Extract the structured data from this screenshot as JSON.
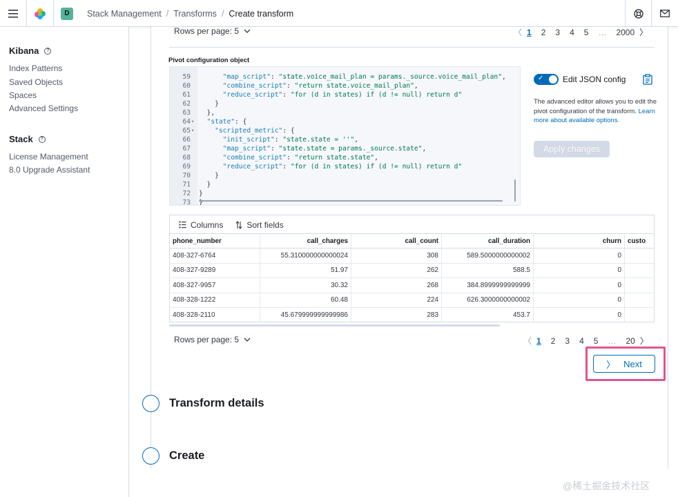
{
  "header": {
    "space_initial": "D",
    "breadcrumbs": [
      "Stack Management",
      "Transforms",
      "Create transform"
    ]
  },
  "sidebar": {
    "sections": [
      {
        "title": "Kibana",
        "items": [
          "Index Patterns",
          "Saved Objects",
          "Spaces",
          "Advanced Settings"
        ]
      },
      {
        "title": "Stack",
        "items": [
          "License Management",
          "8.0 Upgrade Assistant"
        ]
      }
    ]
  },
  "top_pager": {
    "rows_label": "Rows per page: 5",
    "pages": [
      "1",
      "2",
      "3",
      "4",
      "5",
      "…",
      "2000"
    ]
  },
  "pivot": {
    "label": "Pivot configuration object",
    "lines": [
      {
        "n": "59",
        "fold": "",
        "text": "      \"map_script\": \"state.voice_mail_plan = params._source.voice_mail_plan\","
      },
      {
        "n": "60",
        "fold": "",
        "text": "      \"combine_script\": \"return state.voice_mail_plan\","
      },
      {
        "n": "61",
        "fold": "",
        "text": "      \"reduce_script\": \"for (d in states) if (d != null) return d\""
      },
      {
        "n": "62",
        "fold": "",
        "text": "    }"
      },
      {
        "n": "63",
        "fold": "",
        "text": "  },"
      },
      {
        "n": "64",
        "fold": "▾",
        "text": "  \"state\": {"
      },
      {
        "n": "65",
        "fold": "▾",
        "text": "    \"scripted_metric\": {"
      },
      {
        "n": "66",
        "fold": "",
        "text": "      \"init_script\": \"state.state = ''\","
      },
      {
        "n": "67",
        "fold": "",
        "text": "      \"map_script\": \"state.state = params._source.state\","
      },
      {
        "n": "68",
        "fold": "",
        "text": "      \"combine_script\": \"return state.state\","
      },
      {
        "n": "69",
        "fold": "",
        "text": "      \"reduce_script\": \"for (d in states) if (d != null) return d\""
      },
      {
        "n": "70",
        "fold": "",
        "text": "    }"
      },
      {
        "n": "71",
        "fold": "",
        "text": "  }"
      },
      {
        "n": "72",
        "fold": "",
        "text": "}"
      },
      {
        "n": "73",
        "fold": "",
        "text": "}"
      }
    ]
  },
  "json_panel": {
    "toggle_label": "Edit JSON config",
    "toggle_on": true,
    "description": "The advanced editor allows you to edit the pivot configuration of the transform.",
    "link_text": "Learn more about available options.",
    "apply_label": "Apply changes"
  },
  "grid": {
    "toolbar": {
      "columns_label": "Columns",
      "sort_label": "Sort fields"
    },
    "columns": [
      "phone_number",
      "call_charges",
      "call_count",
      "call_duration",
      "churn",
      "custo"
    ],
    "rows": [
      [
        "408-327-6764",
        "55.310000000000024",
        "308",
        "589.5000000000002",
        "0",
        ""
      ],
      [
        "408-327-9289",
        "51.97",
        "262",
        "588.5",
        "0",
        ""
      ],
      [
        "408-327-9957",
        "30.32",
        "268",
        "384.8999999999999",
        "0",
        ""
      ],
      [
        "408-328-1222",
        "60.48",
        "224",
        "626.3000000000002",
        "0",
        ""
      ],
      [
        "408-328-2110",
        "45.679999999999986",
        "283",
        "453.7",
        "0",
        ""
      ]
    ]
  },
  "bottom_pager": {
    "rows_label": "Rows per page: 5",
    "pages": [
      "1",
      "2",
      "3",
      "4",
      "5",
      "…",
      "20"
    ]
  },
  "next_label": "Next",
  "steps": [
    {
      "title": "Transform details"
    },
    {
      "title": "Create"
    }
  ],
  "watermark": "@稀土掘金技术社区",
  "colors": {
    "primary": "#006bb8",
    "highlight": "#e0568a",
    "space_avatar": "#54b399"
  }
}
